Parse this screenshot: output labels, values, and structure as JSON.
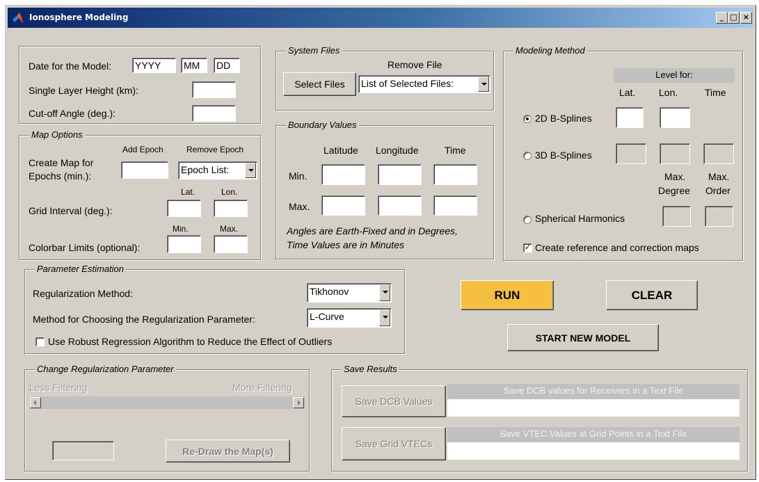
{
  "window": {
    "title": "Ionosphere Modeling",
    "controls": {
      "minimize": "_",
      "maximize": "□",
      "close": "×"
    }
  },
  "model_settings": {
    "date_label": "Date for the Model:",
    "year": "YYYY",
    "month": "MM",
    "day": "DD",
    "layer_height_label": "Single Layer Height (km):",
    "layer_height_value": "",
    "cutoff_label": "Cut-off Angle (deg.):",
    "cutoff_value": ""
  },
  "map_options": {
    "legend": "Map Options",
    "add_epoch_header": "Add Epoch",
    "remove_epoch_header": "Remove Epoch",
    "create_map_label_1": "Create Map for",
    "create_map_label_2": "Epochs (min.):",
    "epoch_value": "",
    "epoch_list": "Epoch List:",
    "grid_interval_label": "Grid Interval (deg.):",
    "lat_header": "Lat.",
    "lon_header": "Lon.",
    "colorbar_label": "Colorbar Limits (optional):",
    "min_header": "Min.",
    "max_header": "Max."
  },
  "system_files": {
    "legend": "System Files",
    "select_button": "Select Files",
    "remove_header": "Remove File",
    "selected_list": "List of Selected Files:"
  },
  "boundary_values": {
    "legend": "Boundary Values",
    "latitude_header": "Latitude",
    "longitude_header": "Longitude",
    "time_header": "Time",
    "min_label": "Min.",
    "max_label": "Max.",
    "note_line_1": "Angles are Earth-Fixed and in Degrees,",
    "note_line_2": "Time Values are in Minutes"
  },
  "modeling_method": {
    "legend": "Modeling Method",
    "level_for_header": "Level for:",
    "lat_header": "Lat.",
    "lon_header": "Lon.",
    "time_header": "Time",
    "option_2d": "2D B-Splines",
    "option_3d": "3D B-Splines",
    "max_degree_header_1": "Max.",
    "max_degree_header_2": "Degree",
    "max_order_header_1": "Max.",
    "max_order_header_2": "Order",
    "option_sh": "Spherical Harmonics",
    "selected_option": "2D B-Splines",
    "create_ref_maps": "Create reference and correction maps",
    "create_ref_maps_checked": true,
    "accent_color": "#f5bf3f"
  },
  "parameter_estimation": {
    "legend": "Parameter Estimation",
    "reg_method_label": "Regularization Method:",
    "reg_method_value": "Tikhonov",
    "choose_param_label": "Method for Choosing the Regularization Parameter:",
    "choose_param_value": "L-Curve",
    "robust_label": "Use Robust Regression Algorithm to Reduce the Effect of Outliers",
    "robust_checked": false
  },
  "actions": {
    "run": "RUN",
    "clear": "CLEAR",
    "start_new": "START NEW MODEL"
  },
  "change_regularization": {
    "legend": "Change Regularization Parameter",
    "less_filtering": "Less Filtering",
    "more_filtering": "More Filtering",
    "value": "",
    "redraw_button": "Re-Draw the Map(s)"
  },
  "save_results": {
    "legend": "Save Results",
    "save_dcb_button": "Save DCB Values",
    "save_dcb_caption": "Save DCB values for Receivers in a Text File",
    "save_vtec_button": "Save Grid VTECs",
    "save_vtec_caption": "Save VTEC Values at Grid Points in a Text File"
  }
}
